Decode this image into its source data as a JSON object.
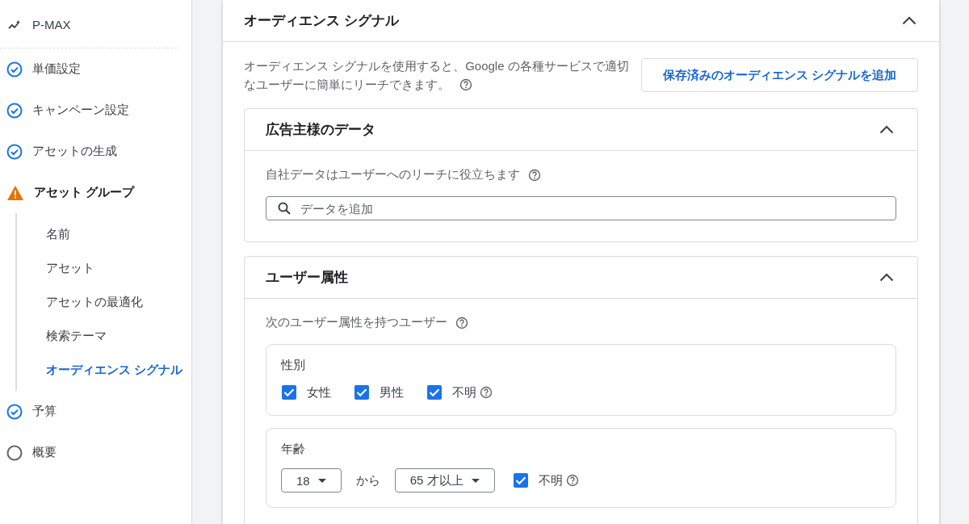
{
  "sidebar": {
    "campaign_type": "P-MAX",
    "steps": [
      {
        "label": "単価設定",
        "kind": "done"
      },
      {
        "label": "キャンペーン設定",
        "kind": "done"
      },
      {
        "label": "アセットの生成",
        "kind": "done"
      },
      {
        "label": "アセット グループ",
        "kind": "warning",
        "children": [
          {
            "label": "名前",
            "selected": false
          },
          {
            "label": "アセット",
            "selected": false
          },
          {
            "label": "アセットの最適化",
            "selected": false
          },
          {
            "label": "検索テーマ",
            "selected": false
          },
          {
            "label": "オーディエンス シグナル",
            "selected": true
          }
        ]
      },
      {
        "label": "予算",
        "kind": "done"
      },
      {
        "label": "概要",
        "kind": "todo"
      }
    ]
  },
  "panel": {
    "title": "オーディエンス シグナル",
    "expanded": true,
    "description_lines": [
      "オーディエンス シグナルを使用すると、Google の各種サービスで適切",
      "なユーザーに簡単にリーチできます。"
    ],
    "add_button": "保存済みのオーディエンス シグナルを追加",
    "sections": [
      {
        "kind": "search",
        "title": "広告主様のデータ",
        "expanded": true,
        "hint": "自社データはユーザーへのリーチに役立ちます",
        "placeholder": "データを追加"
      },
      {
        "kind": "demographics",
        "title": "ユーザー属性",
        "expanded": true,
        "hint": "次のユーザー属性を持つユーザー",
        "groups": [
          {
            "kind": "checkboxes",
            "label": "性別",
            "options": [
              {
                "label": "女性",
                "checked": true,
                "help": false
              },
              {
                "label": "男性",
                "checked": true,
                "help": false
              },
              {
                "label": "不明",
                "checked": true,
                "help": true
              }
            ]
          },
          {
            "kind": "age",
            "label": "年齢",
            "from": "18",
            "connector": "から",
            "to": "65 才以上",
            "unknown": {
              "label": "不明",
              "checked": true,
              "help": true
            }
          }
        ]
      }
    ]
  }
}
